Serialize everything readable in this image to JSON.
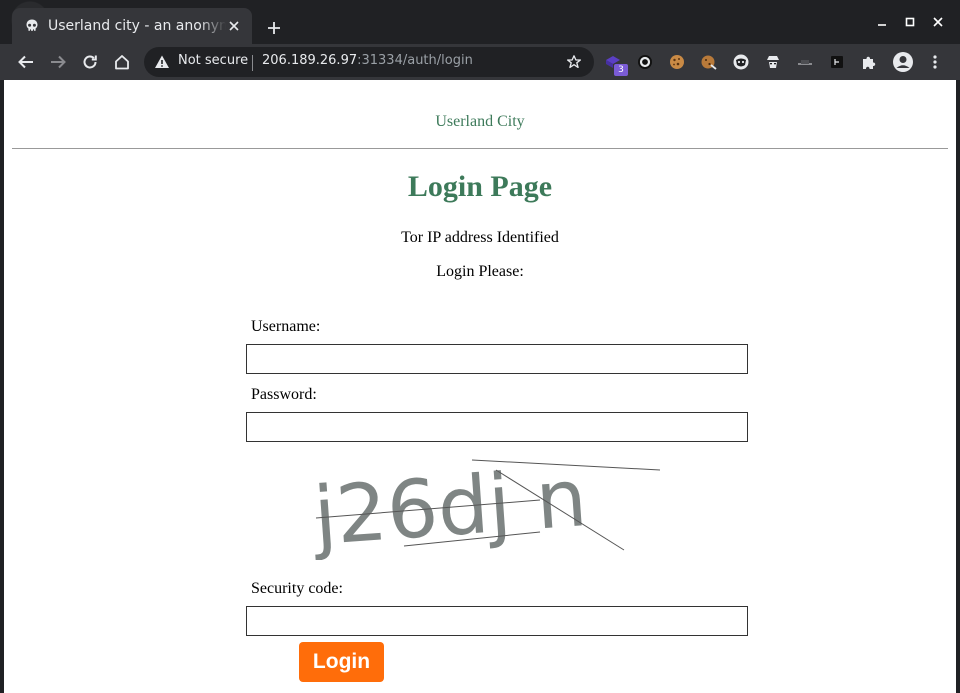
{
  "browser": {
    "tab": {
      "title": "Userland city - an anonymous",
      "favicon": "skull-icon"
    },
    "omnibox": {
      "security_label": "Not secure",
      "url_host": "206.189.26.97",
      "url_rest": ":31334/auth/login"
    },
    "extensions": {
      "badge_count": "3"
    }
  },
  "page": {
    "site_name": "Userland City",
    "title": "Login Page",
    "notice": "Tor IP address Identified",
    "prompt": "Login Please:",
    "username_label": "Username:",
    "username_value": "",
    "password_label": "Password:",
    "password_value": "",
    "captcha_text": "j26dj n",
    "security_code_label": "Security code:",
    "security_code_value": "",
    "login_button": "Login"
  },
  "colors": {
    "accent_green": "#3d7a5a",
    "button_orange": "#ff6d0a",
    "captcha_gray": "#7f8584",
    "browser_dark": "#202124",
    "toolbar": "#35363a"
  }
}
